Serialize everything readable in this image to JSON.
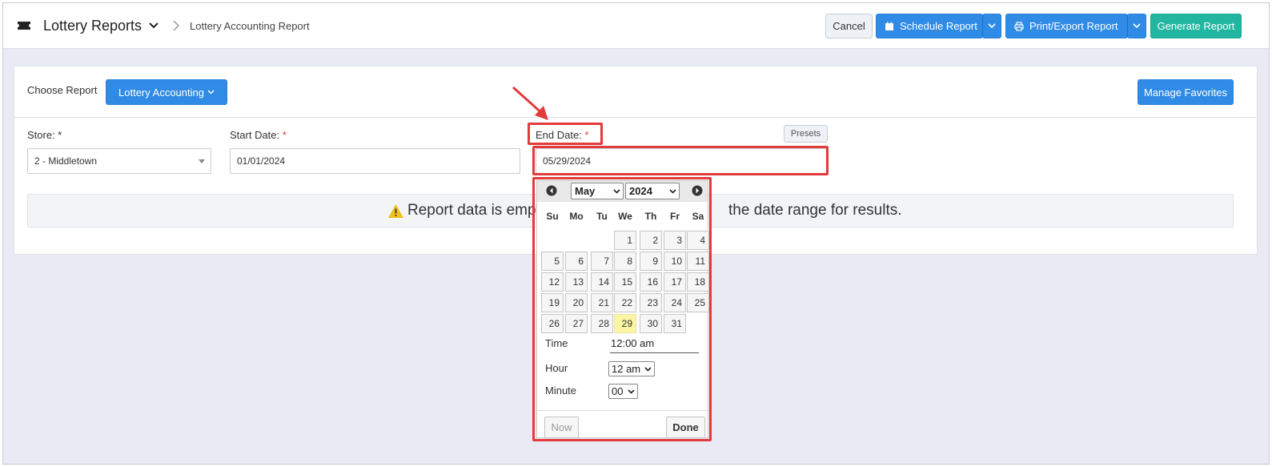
{
  "header": {
    "app_title": "Lottery Reports",
    "breadcrumb": "Lottery Accounting Report",
    "cancel_label": "Cancel",
    "schedule_label": "Schedule Report",
    "print_label": "Print/Export Report",
    "generate_label": "Generate Report"
  },
  "controls": {
    "choose_label": "Choose Report",
    "report_button": "Lottery Accounting",
    "favorites_button": "Manage Favorites",
    "store_label": "Store: *",
    "start_label": "Start Date: ",
    "end_label": "End Date: ",
    "required_mark": "*",
    "presets_label": "Presets",
    "store_value": "2 - Middletown",
    "start_value": "01/01/2024",
    "end_value": "05/29/2024"
  },
  "message": {
    "text_visible_left": "Report data is empty.",
    "text_visible_right": "the date range for results."
  },
  "datepicker": {
    "month": "May",
    "year": "2024",
    "weekdays": [
      "Su",
      "Mo",
      "Tu",
      "We",
      "Th",
      "Fr",
      "Sa"
    ],
    "selected_day": "29",
    "weeks": [
      [
        "",
        "",
        "",
        "1",
        "2",
        "3",
        "4"
      ],
      [
        "5",
        "6",
        "7",
        "8",
        "9",
        "10",
        "11"
      ],
      [
        "12",
        "13",
        "14",
        "15",
        "16",
        "17",
        "18"
      ],
      [
        "19",
        "20",
        "21",
        "22",
        "23",
        "24",
        "25"
      ],
      [
        "26",
        "27",
        "28",
        "29",
        "30",
        "31",
        ""
      ]
    ],
    "time_label": "Time",
    "time_value": "12:00 am",
    "hour_label": "Hour",
    "hour_value": "12 am",
    "minute_label": "Minute",
    "minute_value": "00",
    "now_label": "Now",
    "done_label": "Done"
  },
  "colors": {
    "primary": "#2f8be6",
    "success": "#22b5a0",
    "annotation": "#e23b3b",
    "today_highlight": "#fbf6a4"
  }
}
